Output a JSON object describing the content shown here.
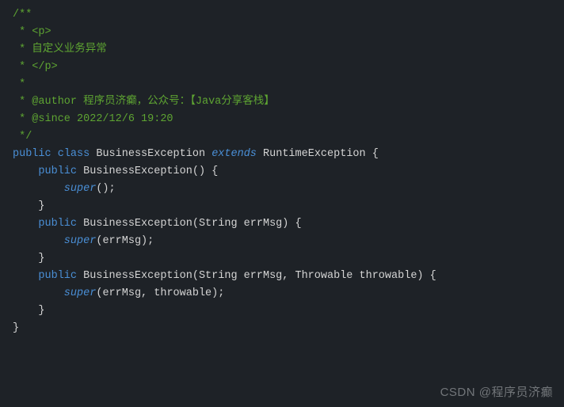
{
  "comments": {
    "l1": "/**",
    "l2": " * <p>",
    "l3": " * 自定义业务异常",
    "l4": " * </p>",
    "l5": " *",
    "l6": " * @author 程序员济癫，公众号：【Java分享客栈】",
    "l7": " * @since 2022/12/6 19:20",
    "l8": " */"
  },
  "code": {
    "public": "public",
    "class": "class",
    "className": "BusinessException",
    "extends": "extends",
    "parentClass": "RuntimeException",
    "openBrace": " {",
    "closeBraceIndent1": "    }",
    "closeBrace": "}",
    "empty": "",
    "ctor1": {
      "sig_public": "    public",
      "sig_name": " BusinessException",
      "sig_parens": "() {",
      "body_super": "        super",
      "body_parens": "();"
    },
    "ctor2": {
      "sig_public": "    public",
      "sig_name": " BusinessException",
      "sig_open": "(",
      "sig_type1": "String",
      "sig_param1": " errMsg",
      "sig_close": ") {",
      "body_super": "        super",
      "body_open": "(",
      "body_arg": "errMsg",
      "body_close": ");"
    },
    "ctor3": {
      "sig_public": "    public",
      "sig_name": " BusinessException",
      "sig_open": "(",
      "sig_type1": "String",
      "sig_param1": " errMsg",
      "sig_comma": ", ",
      "sig_type2": "Throwable",
      "sig_param2": " throwable",
      "sig_close": ") {",
      "body_super": "        super",
      "body_open": "(",
      "body_arg1": "errMsg",
      "body_comma": ", ",
      "body_arg2": "throwable",
      "body_close": ");"
    }
  },
  "watermark": "CSDN @程序员济癫"
}
